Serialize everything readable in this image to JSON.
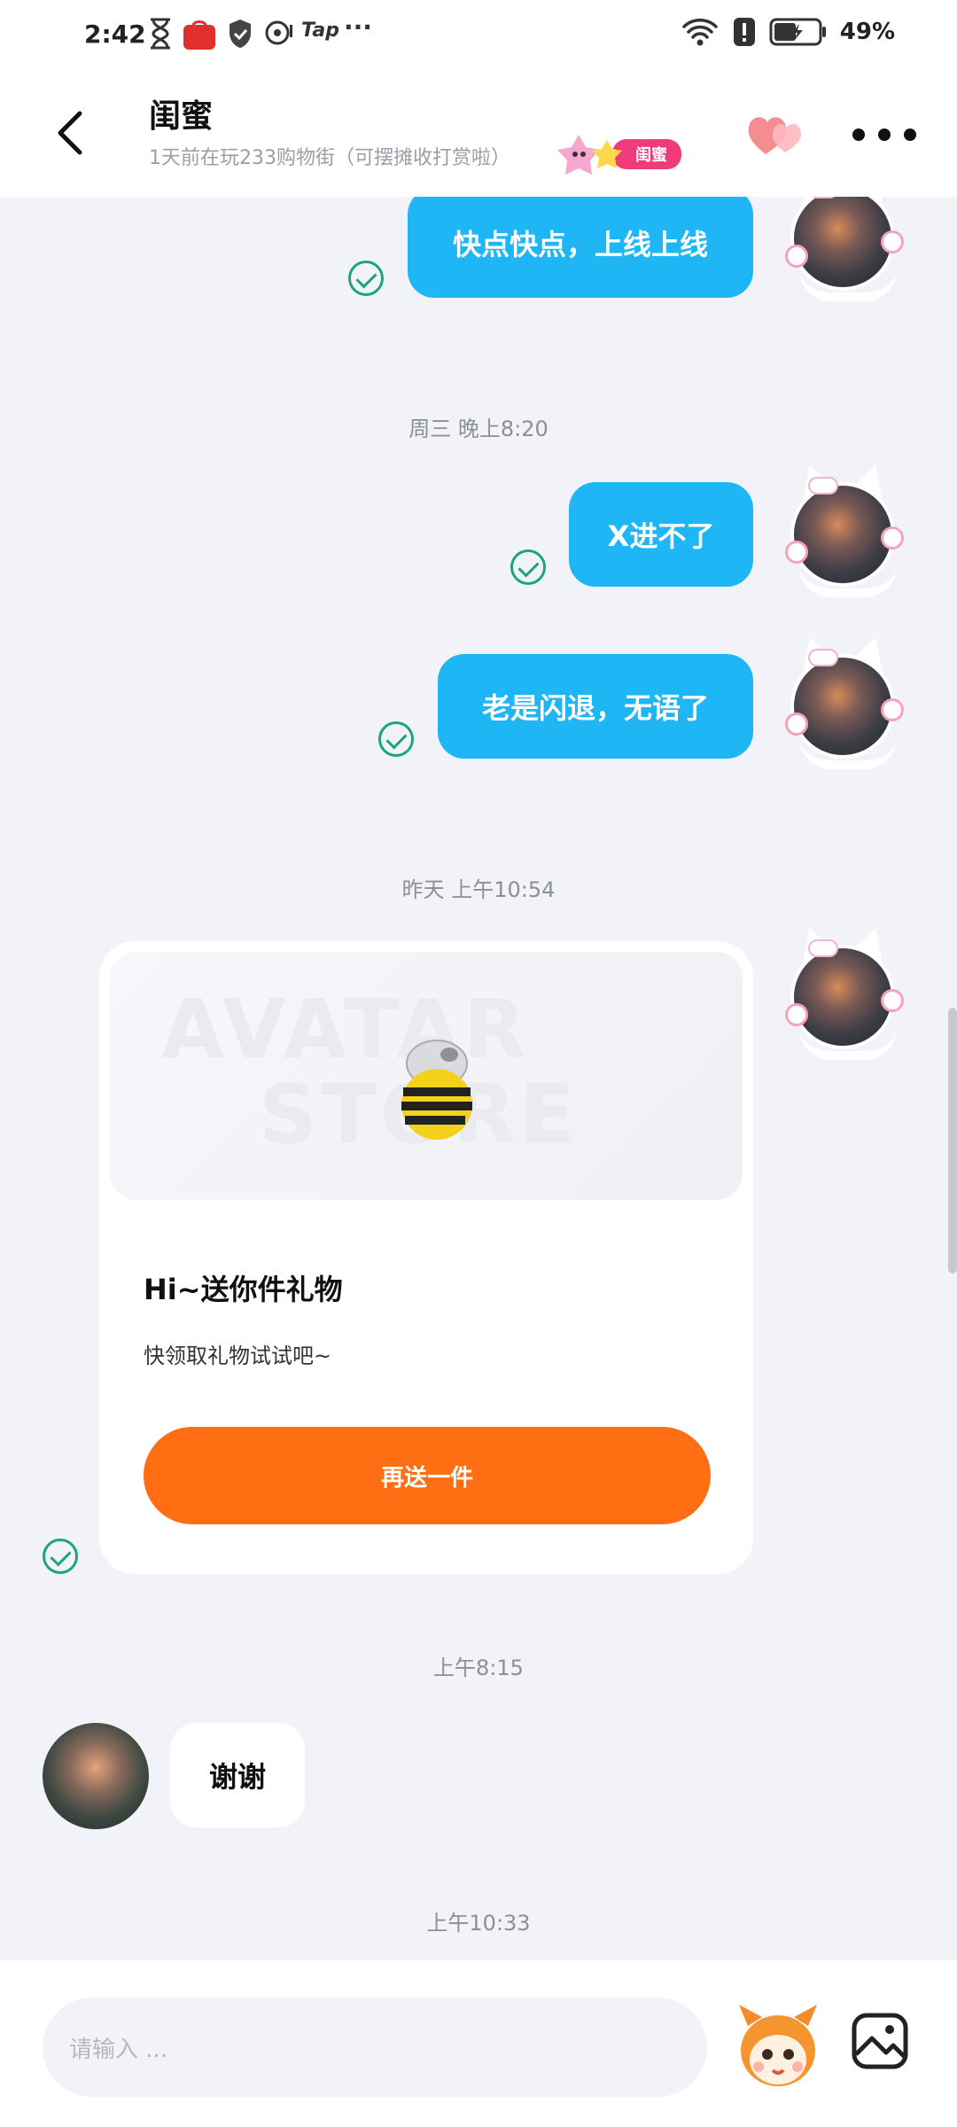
{
  "status_bar": {
    "time": "2:42",
    "tap_label": "Tap",
    "overflow": "···",
    "battery": "49%"
  },
  "header": {
    "title": "闺蜜",
    "subtitle": "1天前在玩233购物街（可摆摊收打赏啦）",
    "relationship_badge": "闺蜜"
  },
  "messages": {
    "out_1": "快点快点，上线上线",
    "time_1": "周三 晚上8:20",
    "out_2": "X进不了",
    "out_3": "老是闪退，无语了",
    "time_2": "昨天 上午10:54",
    "time_3": "上午8:15",
    "in_1": "谢谢",
    "time_4": "上午10:33"
  },
  "gift_card": {
    "watermark_line1": "AVATAR",
    "watermark_line2": "STORE",
    "title": "Hi~送你件礼物",
    "description": "快领取礼物试试吧~",
    "button_label": "再送一件"
  },
  "input": {
    "placeholder": "请输入 ..."
  },
  "colors": {
    "outgoing_bubble": "#1FB6F5",
    "gift_button": "#FF6E12",
    "badge_pink": "#F03A7A",
    "sent_check": "#1BA57A"
  }
}
